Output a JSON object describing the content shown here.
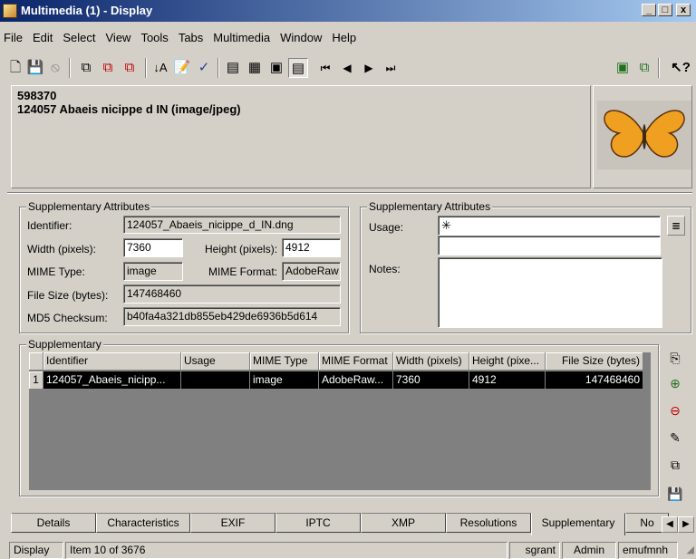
{
  "window": {
    "title": "Multimedia (1) - Display",
    "minimize": "_",
    "maximize": "□",
    "close": "x"
  },
  "menu": [
    "File",
    "Edit",
    "Select",
    "View",
    "Tools",
    "Tabs",
    "Multimedia",
    "Window",
    "Help"
  ],
  "record": {
    "irn": "598370",
    "summary": "124057 Abaeis nicippe d IN (image/jpeg)"
  },
  "supp_left": {
    "group_label": "Supplementary Attributes",
    "identifier_label": "Identifier:",
    "identifier_value": "124057_Abaeis_nicippe_d_IN.dng",
    "width_label": "Width (pixels):",
    "width_value": "7360",
    "height_label": "Height (pixels):",
    "height_value": "4912",
    "mime_type_label": "MIME Type:",
    "mime_type_value": "image",
    "mime_format_label": "MIME Format:",
    "mime_format_value": "AdobeRaw",
    "file_size_label": "File Size (bytes):",
    "file_size_value": "147468460",
    "md5_label": "MD5 Checksum:",
    "md5_value": "b40fa4a321db855eb429de6936b5d614"
  },
  "supp_right": {
    "group_label": "Supplementary Attributes",
    "usage_label": "Usage:",
    "usage_value": "✳",
    "notes_label": "Notes:",
    "notes_value": ""
  },
  "grid": {
    "group_label": "Supplementary",
    "columns": [
      "Identifier",
      "Usage",
      "MIME Type",
      "MIME Format",
      "Width (pixels)",
      "Height (pixe...",
      "File Size (bytes)"
    ],
    "rows": [
      {
        "num": "1",
        "identifier": "124057_Abaeis_nicipp...",
        "usage": "",
        "mime_type": "image",
        "mime_format": "AdobeRaw...",
        "width": "7360",
        "height": "4912",
        "file_size": "147468460"
      }
    ]
  },
  "tabs": [
    "Details",
    "Characteristics",
    "EXIF",
    "IPTC",
    "XMP",
    "Resolutions",
    "Supplementary",
    "No"
  ],
  "status": {
    "mode": "Display",
    "item": "Item 10 of 3676",
    "user": "sgrant",
    "group": "Admin",
    "host": "emufmnh"
  },
  "colors": {
    "titlebar_start": "#0a246a",
    "titlebar_end": "#a6caf0",
    "face": "#d4d0c8",
    "selection": "#000000",
    "butterfly": "#f0a020"
  }
}
